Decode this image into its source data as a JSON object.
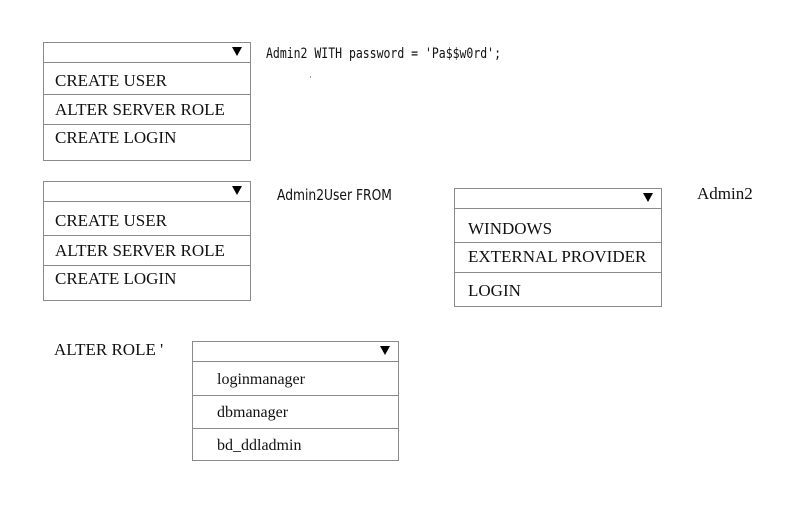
{
  "statements": {
    "line1_suffix": "Admin2 WITH password = 'Pa$$w0rd';",
    "line2_middle": "Admin2User FROM",
    "line2_suffix": "Admin2",
    "line3_prefix": "ALTER  ROLE '"
  },
  "dropdowns": [
    {
      "selected": "",
      "options": [
        "CREATE USER",
        "ALTER SERVER ROLE",
        "CREATE LOGIN"
      ]
    },
    {
      "selected": "",
      "options": [
        "CREATE USER",
        "ALTER SERVER ROLE",
        "CREATE LOGIN"
      ]
    },
    {
      "selected": "",
      "options": [
        "WINDOWS",
        "EXTERNAL PROVIDER",
        "LOGIN"
      ]
    },
    {
      "selected": "",
      "options": [
        "loginmanager",
        "dbmanager",
        "bd_ddladmin"
      ]
    }
  ],
  "icons": {
    "dropdown_arrow": "triangle-down"
  },
  "colors": {
    "border": "#8a8a8a",
    "text": "#111111",
    "background": "#ffffff"
  }
}
